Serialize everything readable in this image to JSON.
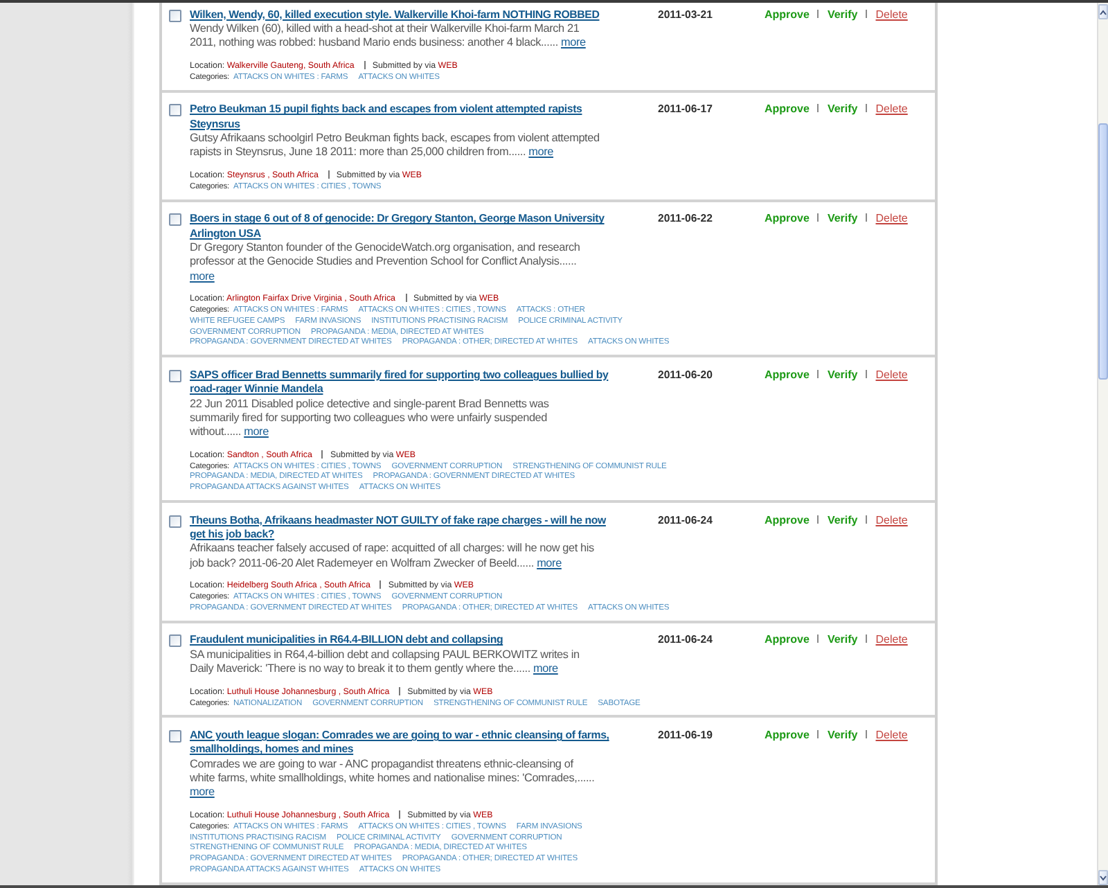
{
  "reports": [
    {
      "checked": false,
      "title": "Wilken, Wendy, 60, killed execution style. Walkerville Khoi-farm NOTHING ROBBED",
      "date": "2011-03-21",
      "actions": [
        {
          "kind": "approve",
          "label": "Approve"
        },
        {
          "kind": "verify",
          "label": "Verify"
        },
        {
          "kind": "delete",
          "label": "Delete"
        }
      ],
      "description": "Wendy Wilken (60), killed with a head-shot at their Walkerville Khoi-farm March 21 2011, nothing was robbed: husband Mario ends business: another 4 black......",
      "more": "more",
      "location_label": "Location:",
      "location": "Walkerville Gauteng, South Africa",
      "submitted_label": "Submitted by via",
      "source": "WEB",
      "categories_label": "Categories:",
      "categories": [
        "ATTACKS ON WHITES : FARMS",
        "ATTACKS ON WHITES"
      ]
    },
    {
      "checked": false,
      "title": "Petro Beukman 15 pupil fights back and escapes from violent attempted rapists Steynsrus",
      "date": "2011-06-17",
      "actions": [
        {
          "kind": "approve",
          "label": "Approve"
        },
        {
          "kind": "verify",
          "label": "Verify"
        },
        {
          "kind": "delete",
          "label": "Delete"
        }
      ],
      "description": "Gutsy Afrikaans schoolgirl Petro Beukman fights back, escapes from violent attempted rapists in Steynsrus, June 18 2011: more than 25,000 children from......",
      "more": "more",
      "location_label": "Location:",
      "location": "Steynsrus , South Africa",
      "submitted_label": "Submitted by via",
      "source": "WEB",
      "categories_label": "Categories:",
      "categories": [
        "ATTACKS ON WHITES : CITIES , TOWNS"
      ]
    },
    {
      "checked": false,
      "title": "Boers in stage 6 out of 8 of genocide: Dr Gregory Stanton, George Mason University Arlington USA",
      "date": "2011-06-22",
      "actions": [
        {
          "kind": "approve",
          "label": "Approve"
        },
        {
          "kind": "verify",
          "label": "Verify"
        },
        {
          "kind": "delete",
          "label": "Delete"
        }
      ],
      "description": "Dr Gregory Stanton founder of the GenocideWatch.org organisation, and research professor at the Genocide Studies and Prevention School for Conflict Analysis......",
      "more": "more",
      "location_label": "Location:",
      "location": "Arlington Fairfax Drive Virginia , South Africa",
      "submitted_label": "Submitted by via",
      "source": "WEB",
      "categories_label": "Categories:",
      "categories": [
        "ATTACKS ON WHITES : FARMS",
        "ATTACKS ON WHITES : CITIES , TOWNS",
        "ATTACKS : OTHER",
        "WHITE REFUGEE CAMPS",
        "FARM INVASIONS",
        "INSTITUTIONS PRACTISING RACISM",
        "POLICE CRIMINAL ACTIVITY",
        "GOVERNMENT CORRUPTION",
        "PROPAGANDA : MEDIA, DIRECTED AT WHITES",
        "PROPAGANDA : GOVERNMENT DIRECTED AT WHITES",
        "PROPAGANDA : OTHER; DIRECTED AT WHITES",
        "ATTACKS ON WHITES"
      ]
    },
    {
      "checked": false,
      "title": "SAPS officer Brad Bennetts summarily fired for supporting two colleagues bullied by road-rager Winnie Mandela",
      "date": "2011-06-20",
      "actions": [
        {
          "kind": "approve",
          "label": "Approve"
        },
        {
          "kind": "verify",
          "label": "Verify"
        },
        {
          "kind": "delete",
          "label": "Delete"
        }
      ],
      "description": "22 Jun 2011 Disabled police detective and single-parent Brad Bennetts was summarily fired for supporting two colleagues who were unfairly suspended without......",
      "more": "more",
      "location_label": "Location:",
      "location": "Sandton , South Africa",
      "submitted_label": "Submitted by via",
      "source": "WEB",
      "categories_label": "Categories:",
      "categories": [
        "ATTACKS ON WHITES : CITIES , TOWNS",
        "GOVERNMENT CORRUPTION",
        "STRENGTHENING OF COMMUNIST RULE",
        "PROPAGANDA : MEDIA, DIRECTED AT WHITES",
        "PROPAGANDA : GOVERNMENT DIRECTED AT WHITES",
        "PROPAGANDA ATTACKS AGAINST WHITES",
        "ATTACKS ON WHITES"
      ]
    },
    {
      "checked": false,
      "title": "Theuns Botha, Afrikaans headmaster NOT GUILTY of fake rape charges - will he now get his job back?",
      "date": "2011-06-24",
      "actions": [
        {
          "kind": "approve",
          "label": "Approve"
        },
        {
          "kind": "verify",
          "label": "Verify"
        },
        {
          "kind": "delete",
          "label": "Delete"
        }
      ],
      "description": "Afrikaans teacher falsely accused of rape: acquitted of all charges: will he now get his job back? 2011-06-20 Alet Rademeyer en Wolfram Zwecker of Beeld......",
      "more": "more",
      "location_label": "Location:",
      "location": "Heidelberg South Africa , South Africa",
      "submitted_label": "Submitted by via",
      "source": "WEB",
      "categories_label": "Categories:",
      "categories": [
        "ATTACKS ON WHITES : CITIES , TOWNS",
        "GOVERNMENT CORRUPTION",
        "PROPAGANDA : GOVERNMENT DIRECTED AT WHITES",
        "PROPAGANDA : OTHER; DIRECTED AT WHITES",
        "ATTACKS ON WHITES"
      ]
    },
    {
      "checked": false,
      "title": "Fraudulent municipalities in R64.4-BILLION debt and collapsing",
      "date": "2011-06-24",
      "actions": [
        {
          "kind": "approve",
          "label": "Approve"
        },
        {
          "kind": "verify",
          "label": "Verify"
        },
        {
          "kind": "delete",
          "label": "Delete"
        }
      ],
      "description": "SA municipalities in R64,4-billion debt and collapsing PAUL BERKOWITZ writes in Daily Maverick: 'There is no way to break it to them gently where the......",
      "more": "more",
      "location_label": "Location:",
      "location": "Luthuli House Johannesburg , South Africa",
      "submitted_label": "Submitted by via",
      "source": "WEB",
      "categories_label": "Categories:",
      "categories": [
        "NATIONALIZATION",
        "GOVERNMENT CORRUPTION",
        "STRENGTHENING OF COMMUNIST RULE",
        "SABOTAGE"
      ]
    },
    {
      "checked": false,
      "title": "ANC youth league slogan: Comrades we are going to war - ethnic cleansing of farms, smallholdings, homes and mines",
      "date": "2011-06-19",
      "actions": [
        {
          "kind": "approve",
          "label": "Approve"
        },
        {
          "kind": "verify",
          "label": "Verify"
        },
        {
          "kind": "delete",
          "label": "Delete"
        }
      ],
      "description": "Comrades we are going to war - ANC propagandist threatens ethnic-cleansing of white farms, white smallholdings, white homes and nationalise mines: 'Comrades,......",
      "more": "more",
      "location_label": "Location:",
      "location": "Luthuli House Johannesburg , South Africa",
      "submitted_label": "Submitted by via",
      "source": "WEB",
      "categories_label": "Categories:",
      "categories": [
        "ATTACKS ON WHITES : FARMS",
        "ATTACKS ON WHITES : CITIES , TOWNS",
        "FARM INVASIONS",
        "INSTITUTIONS PRACTISING RACISM",
        "POLICE CRIMINAL ACTIVITY",
        "GOVERNMENT CORRUPTION",
        "STRENGTHENING OF COMMUNIST RULE",
        "PROPAGANDA : MEDIA, DIRECTED AT WHITES",
        "PROPAGANDA : GOVERNMENT DIRECTED AT WHITES",
        "PROPAGANDA : OTHER; DIRECTED AT WHITES",
        "PROPAGANDA ATTACKS AGAINST WHITES",
        "ATTACKS ON WHITES"
      ]
    }
  ]
}
